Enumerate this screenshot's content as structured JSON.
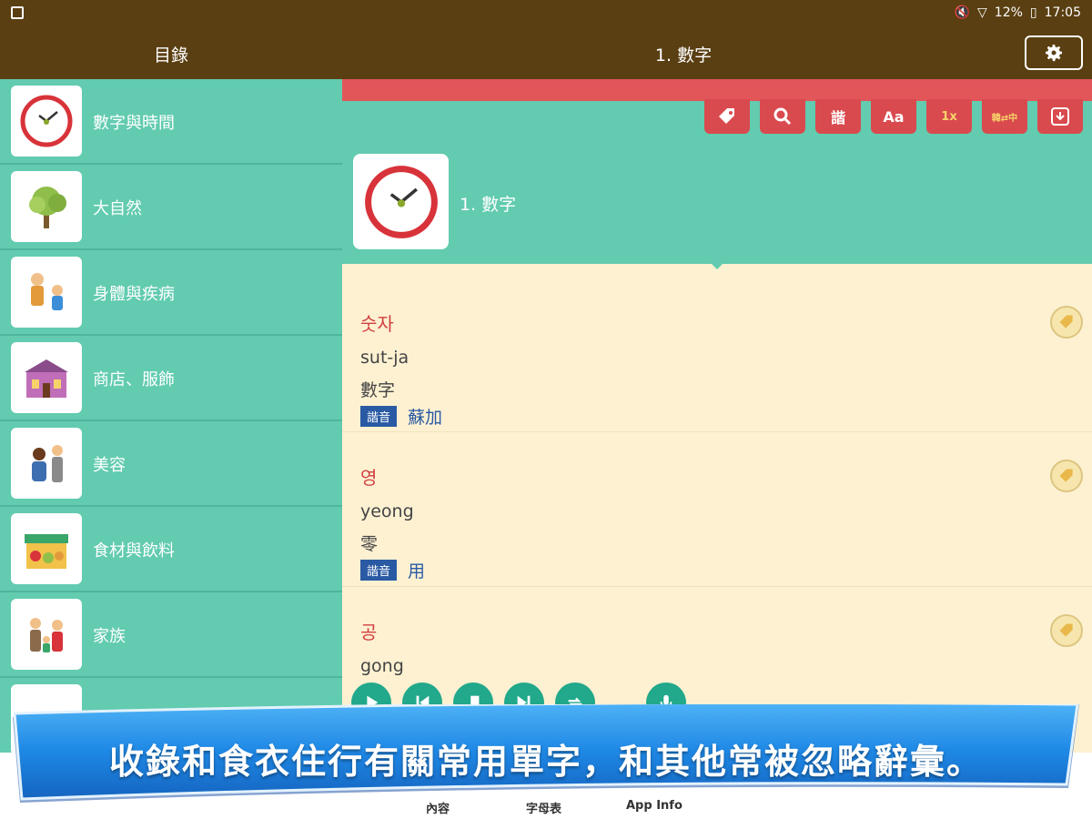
{
  "status_bar": {
    "battery": "12%",
    "time": "17:05"
  },
  "header": {
    "toc_title": "目錄",
    "chapter_title": "1. 數字"
  },
  "sidebar": {
    "items": [
      {
        "label": "數字與時間",
        "icon": "clock-icon"
      },
      {
        "label": "大自然",
        "icon": "tree-icon"
      },
      {
        "label": "身體與疾病",
        "icon": "people-icon"
      },
      {
        "label": "商店、服飾",
        "icon": "shop-icon"
      },
      {
        "label": "美容",
        "icon": "salon-icon"
      },
      {
        "label": "食材與飲料",
        "icon": "grocery-icon"
      },
      {
        "label": "家族",
        "icon": "family-icon"
      }
    ]
  },
  "toolbar": {
    "buttons": [
      {
        "icon": "tag-icon",
        "label": ""
      },
      {
        "icon": "search-icon",
        "label": ""
      },
      {
        "icon": "pronunciation-icon",
        "label": "諧"
      },
      {
        "icon": "font-size-icon",
        "label": "Aa"
      },
      {
        "icon": "speed-icon",
        "label": "1x"
      },
      {
        "icon": "language-swap-icon",
        "label": "韓⇄中"
      },
      {
        "icon": "download-icon",
        "label": ""
      }
    ]
  },
  "chapter": {
    "name": "1. 數字"
  },
  "words": [
    {
      "korean": "숫자",
      "romanization": "sut-ja",
      "meaning": "數字",
      "pron_label": "諧音",
      "pronunciation": "蘇加"
    },
    {
      "korean": "영",
      "romanization": "yeong",
      "meaning": "零",
      "pron_label": "諧音",
      "pronunciation": "用"
    },
    {
      "korean": "공",
      "romanization": "gong",
      "meaning": "",
      "pron_label": "",
      "pronunciation": ""
    }
  ],
  "banner": {
    "text": "收錄和食衣住行有關常用單字，和其他常被忽略辭彙。"
  },
  "bottom_tabs": [
    {
      "label": "內容"
    },
    {
      "label": "字母表"
    },
    {
      "label": "App Info"
    }
  ],
  "colors": {
    "header_bg": "#5a3f12",
    "teal": "#62cbb0",
    "red": "#d94a4e",
    "cream": "#fdf1d2",
    "korean_text": "#d24040",
    "pron_blue": "#2a5aa3",
    "banner_blue": "#1e88e5"
  }
}
